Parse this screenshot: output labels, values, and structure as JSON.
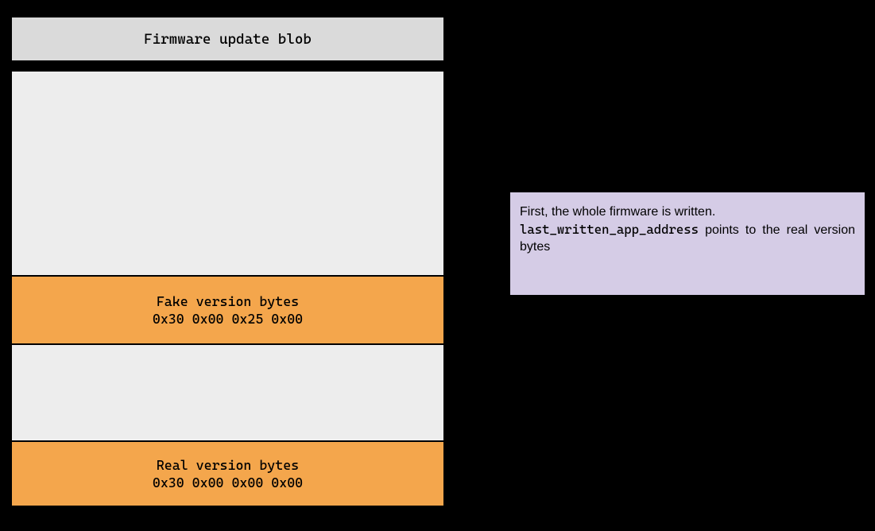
{
  "header": {
    "title": "Firmware update blob"
  },
  "fake_version": {
    "label": "Fake version bytes",
    "bytes": "0x30 0x00 0x25 0x00"
  },
  "real_version": {
    "label": "Real version bytes",
    "bytes": "0x30 0x00 0x00 0x00"
  },
  "note": {
    "line1": "First, the whole firmware is written.",
    "code": "last_written_app_address",
    "line2_rest": "points to the real version",
    "line3": "bytes"
  }
}
